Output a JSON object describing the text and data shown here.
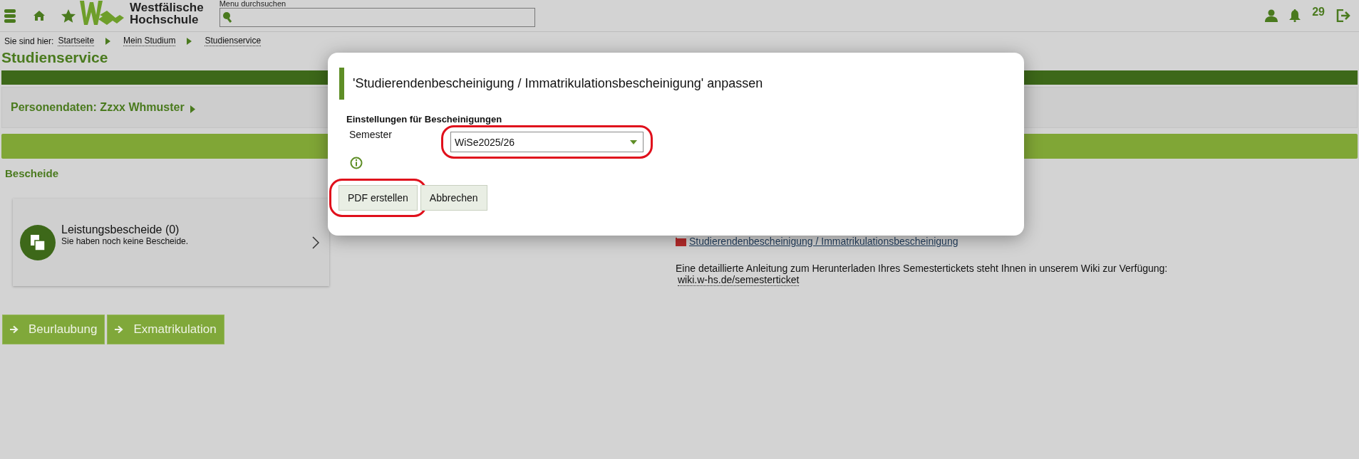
{
  "header": {
    "logo_lines": [
      "Westfälische",
      "Hochschule"
    ],
    "search": {
      "label": "Menu durchsuchen"
    },
    "notification_count": "29"
  },
  "breadcrumb": {
    "label": "Sie sind hier:",
    "items": [
      "Startseite",
      "Mein Studium",
      "Studienservice"
    ]
  },
  "page_title": "Studienservice",
  "person_panel": {
    "label": "Personendaten: Zzxx Whmuster"
  },
  "section_title": "Bescheide",
  "card": {
    "title": "Leistungsbescheide (0)",
    "subtitle": "Sie haben noch keine Bescheide."
  },
  "pdf_link": "Studierendenbescheinigung / Immatrikulationsbescheinigung",
  "info_text": "Eine detaillierte Anleitung zum Herunterladen Ihres Semestertickets steht Ihnen in unserem Wiki zur Verfügung:",
  "wiki_link": "wiki.w-hs.de/semesterticket",
  "actions": [
    "Beurlaubung",
    "Exmatrikulation"
  ],
  "dialog": {
    "title": "'Studierendenbescheinigung / Immatrikulationsbescheinigung' anpassen",
    "section": "Einstellungen für Bescheinigungen",
    "field_label": "Semester",
    "select": {
      "value": "WiSe2025/26",
      "highlighted": true
    },
    "buttons": [
      {
        "label": "PDF erstellen",
        "highlighted": true
      },
      {
        "label": "Abbrechen",
        "highlighted": false
      }
    ]
  }
}
